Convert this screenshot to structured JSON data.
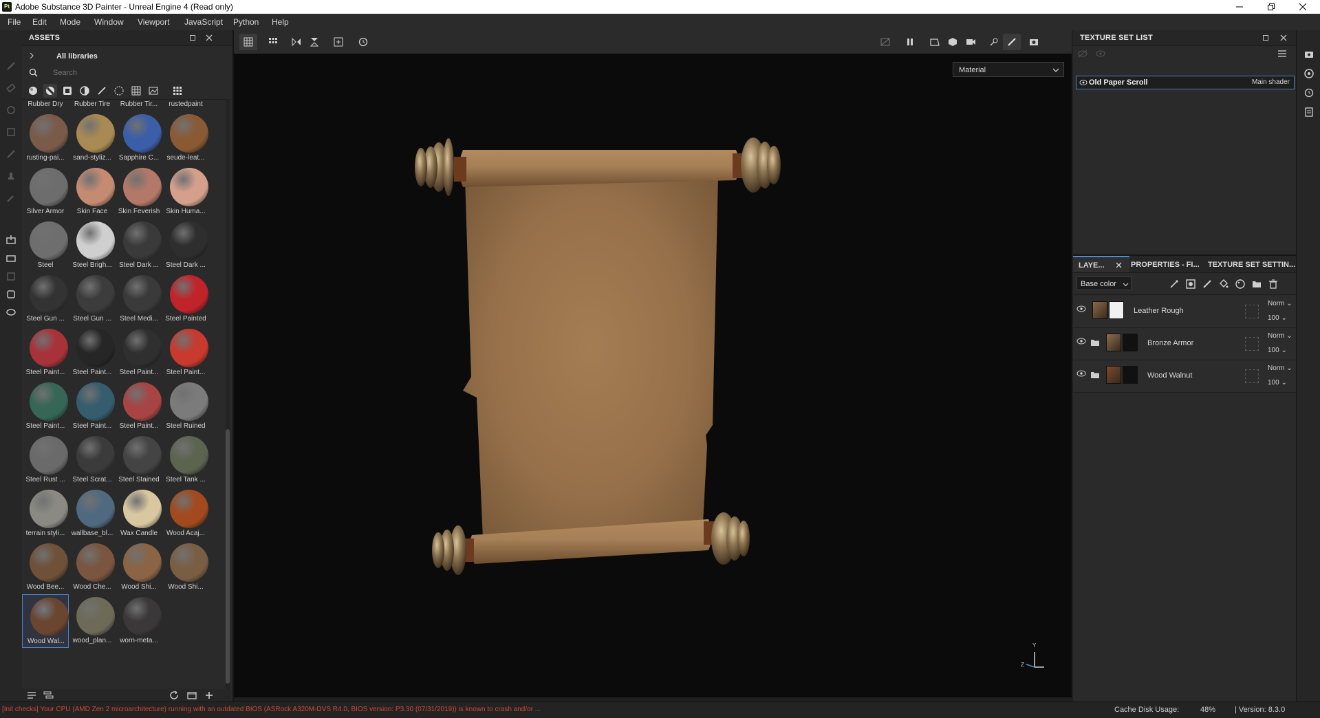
{
  "window": {
    "title": "Adobe Substance 3D Painter - Unreal Engine 4 (Read only)",
    "app_logo": "Pt"
  },
  "menu": [
    "File",
    "Edit",
    "Mode",
    "Window",
    "Viewport",
    "JavaScript",
    "Python",
    "Help"
  ],
  "assets": {
    "title": "ASSETS",
    "library": "All libraries",
    "search_placeholder": "Search",
    "items": [
      {
        "label": "Rubber Dry",
        "color": "#2e2a28"
      },
      {
        "label": "Rubber Tire",
        "color": "#262626"
      },
      {
        "label": "Rubber Tir...",
        "color": "#2b2b2b"
      },
      {
        "label": "rustedpaint",
        "color": "#6b4a2e"
      },
      {
        "label": "rusting-pai...",
        "color": "#7a5b4a"
      },
      {
        "label": "sand-styliz...",
        "color": "#a98a55"
      },
      {
        "label": "Sapphire C...",
        "color": "#3b5ea8"
      },
      {
        "label": "seude-leat...",
        "color": "#8a5a34"
      },
      {
        "label": "Silver Armor",
        "color": "#6d6d6d"
      },
      {
        "label": "Skin Face",
        "color": "#c48a72"
      },
      {
        "label": "Skin Feverish",
        "color": "#b37868"
      },
      {
        "label": "Skin Huma...",
        "color": "#d4a08c"
      },
      {
        "label": "Steel",
        "color": "#6e6e6e"
      },
      {
        "label": "Steel Brigh...",
        "color": "#cfcfcf"
      },
      {
        "label": "Steel Dark ...",
        "color": "#3a3a3a"
      },
      {
        "label": "Steel Dark ...",
        "color": "#2e2e2e"
      },
      {
        "label": "Steel Gun ...",
        "color": "#333333"
      },
      {
        "label": "Steel Gun ...",
        "color": "#3c3c3c"
      },
      {
        "label": "Steel Medi...",
        "color": "#3a3a3a"
      },
      {
        "label": "Steel Painted",
        "color": "#c0242a"
      },
      {
        "label": "Steel Paint...",
        "color": "#a8323a"
      },
      {
        "label": "Steel Paint...",
        "color": "#262626"
      },
      {
        "label": "Steel Paint...",
        "color": "#2f2f2f"
      },
      {
        "label": "Steel Paint...",
        "color": "#c8392e"
      },
      {
        "label": "Steel Paint...",
        "color": "#356656"
      },
      {
        "label": "Steel Paint...",
        "color": "#365d6e"
      },
      {
        "label": "Steel Paint...",
        "color": "#a84444"
      },
      {
        "label": "Steel Ruined",
        "color": "#7b7b7b"
      },
      {
        "label": "Steel Rust ...",
        "color": "#6a6a6a"
      },
      {
        "label": "Steel Scrat...",
        "color": "#3b3b3b"
      },
      {
        "label": "Steel Stained",
        "color": "#444444"
      },
      {
        "label": "Steel Tank ...",
        "color": "#5c6450"
      },
      {
        "label": "terrain styli...",
        "color": "#8a8a82"
      },
      {
        "label": "wallbase_bl...",
        "color": "#4f6a80"
      },
      {
        "label": "Wax Candle",
        "color": "#d8c7a0"
      },
      {
        "label": "Wood Acaj...",
        "color": "#a24a1e"
      },
      {
        "label": "Wood Bee...",
        "color": "#6e5138"
      },
      {
        "label": "Wood Che...",
        "color": "#7a5540"
      },
      {
        "label": "Wood Shi...",
        "color": "#8a6444"
      },
      {
        "label": "Wood Shi...",
        "color": "#7a5e44"
      },
      {
        "label": "Wood Wal...",
        "color": "#6a4530",
        "selected": true
      },
      {
        "label": "wood_plan...",
        "color": "#6d6a58"
      },
      {
        "label": "worn-meta...",
        "color": "#3a3838"
      }
    ]
  },
  "viewport": {
    "material_mode": "Material",
    "axis_y": "Y",
    "axis_z": "Z"
  },
  "texture_set_list": {
    "title": "TEXTURE SET LIST",
    "name": "Old Paper Scroll",
    "shader": "Main shader"
  },
  "layers_panel": {
    "tabs": [
      "LAYE...",
      "PROPERTIES - FI...",
      "TEXTURE SET SETTIN..."
    ],
    "channel": "Base color",
    "layers": [
      {
        "name": "Leather Rough",
        "blend": "Norm",
        "opacity": "100",
        "folder": false,
        "thumb": "#8a6a4a"
      },
      {
        "name": "Bronze Armor",
        "blend": "Norm",
        "opacity": "100",
        "folder": true,
        "thumb": "#8b6f50"
      },
      {
        "name": "Wood Walnut",
        "blend": "Norm",
        "opacity": "100",
        "folder": true,
        "thumb": "#7a4a30"
      }
    ]
  },
  "status": {
    "message": "[Init checks] Your CPU (AMD Zen 2 microarchitecture) running with an outdated BIOS (ASRock A320M-DVS R4.0, BIOS version: P3.30 (07/31/2019)) is known to crash and/or ...",
    "cache_label": "Cache Disk Usage:",
    "cache_value": "48%",
    "version": "| Version: 8.3.0"
  },
  "colors": {
    "accent": "#4c8fd6",
    "warning": "#d04a32"
  }
}
